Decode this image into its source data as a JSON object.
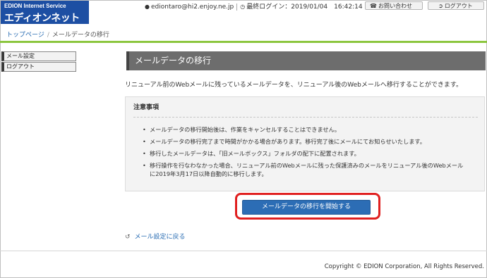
{
  "header": {
    "logo_line1": "EDION Internet Service",
    "logo_line2": "エディオンネット",
    "user_email": "ediontaro@hi2.enjoy.ne.jp",
    "last_login_label": "最終ログイン：",
    "last_login_value": "2019/01/04　16:42:14",
    "contact_label": "お問い合わせ",
    "logout_label": "ログアウト"
  },
  "breadcrumb": {
    "home": "トップページ",
    "separator": "/",
    "current": "メールデータの移行"
  },
  "sidebar": {
    "items": [
      {
        "label": "メール設定"
      },
      {
        "label": "ログアウト"
      }
    ]
  },
  "main": {
    "title": "メールデータの移行",
    "intro": "リニューアル前のWebメールに残っているメールデータを、リニューアル後のWebメールへ移行することができます。",
    "notice": {
      "title": "注意事項",
      "items": [
        "メールデータの移行開始後は、作業をキャンセルすることはできません。",
        "メールデータの移行完了まで時間がかかる場合があります。移行完了後にメールにてお知らせいたします。",
        "移行したメールデータは、「旧メールボックス」フォルダの配下に配置されます。",
        "移行操作を行なわなかった場合、リニューアル前のWebメールに残った保護済みのメールをリニューアル後のWebメール\nに2019年3月17日以降自動的に移行します。"
      ]
    },
    "start_button": "メールデータの移行を開始する",
    "back_link": "メール設定に戻る"
  },
  "footer": {
    "copyright": "Copyright © EDION Corporation, All Rights Reserved."
  },
  "colors": {
    "logo_bg": "#1d4fa3",
    "accent_green": "#8cc63f",
    "title_bar": "#6d6d6d",
    "primary_button": "#2c6db5",
    "highlight_red": "#e02020",
    "link": "#2a6db3"
  },
  "icons": {
    "user": "user-icon",
    "clock": "clock-icon",
    "phone": "phone-icon",
    "logout": "logout-icon",
    "back": "back-arrow-icon"
  }
}
